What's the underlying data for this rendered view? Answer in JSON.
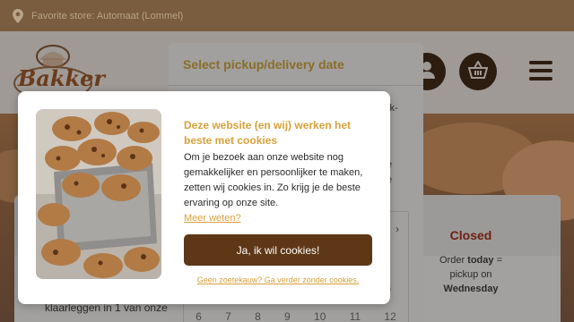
{
  "store_bar": {
    "text": "Favorite store: Automaat (Lommel)",
    "icon": "location-pin-icon"
  },
  "header": {
    "logo_text": "Bakker",
    "icons": [
      "user-icon",
      "basket-icon",
      "hamburger-menu-icon"
    ]
  },
  "date_modal": {
    "title": "Select pickup/delivery date",
    "text_fragments": [
      "ck-",
      "e",
      "e"
    ],
    "calendar": {
      "nav_arrow": "›",
      "day_header_fragment": "U",
      "cell_fragment": "6",
      "week_row": [
        "6",
        "7",
        "8",
        "9",
        "10",
        "11",
        "12"
      ]
    }
  },
  "status_box": {
    "title": "Closed",
    "line1_prefix": "Order ",
    "line1_bold": "today",
    "line1_suffix": " =",
    "line2": "pickup on",
    "line3": "Wednesday"
  },
  "content": {
    "text_fragment": "klaarleggen in 1 van onze"
  },
  "cookie_dialog": {
    "title": "Deze website (en wij) werken het beste met cookies",
    "body": "Om je bezoek aan onze website nog gemakkelijker en persoonlijker te maken, zetten wij cookies in. Zo krijg je de beste ervaring op onze site.",
    "more_link": "Meer weten?",
    "accept_label": "Ja, ik wil cookies!",
    "decline_label": "Geen zoetekauw? Ga verder zonder cookies."
  },
  "colors": {
    "store_bar_bg": "#7a5c3e",
    "accent_gold": "#d7a13b",
    "button_brown": "#5e3716",
    "closed_red": "#6e1f12"
  }
}
